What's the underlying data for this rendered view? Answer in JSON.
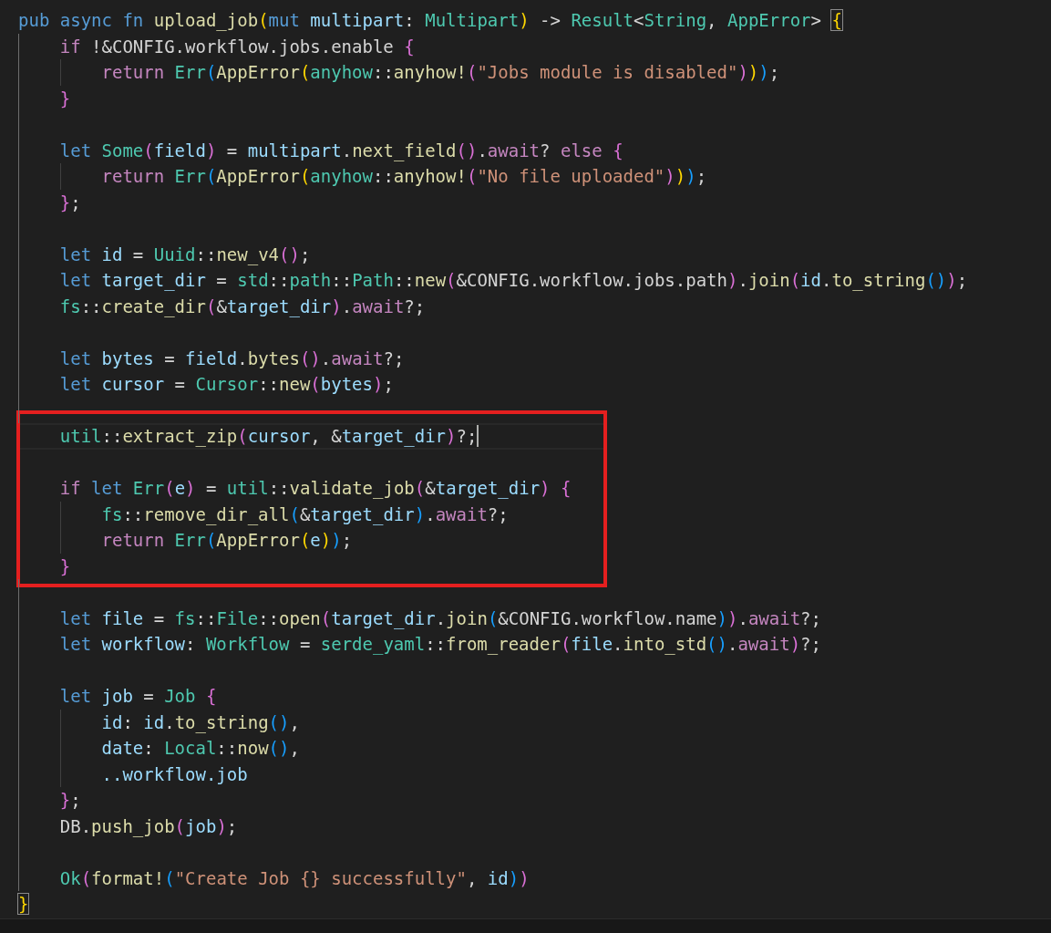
{
  "editor": {
    "lines": [
      {
        "kind": "code",
        "tokens": [
          {
            "text": "pub",
            "kind": "keyword"
          },
          {
            "text": " async",
            "kind": "keyword"
          },
          {
            "text": " fn",
            "kind": "keyword"
          },
          {
            "text": " upload_job",
            "kind": "function"
          },
          {
            "text": "(",
            "kind": "bracket1"
          },
          {
            "text": "mut",
            "kind": "keyword"
          },
          {
            "text": " multipart",
            "kind": "variable"
          },
          {
            "text": ": ",
            "kind": "plain"
          },
          {
            "text": "Multipart",
            "kind": "type"
          },
          {
            "text": ")",
            "kind": "bracket1"
          },
          {
            "text": " -> ",
            "kind": "plain"
          },
          {
            "text": "Result",
            "kind": "type"
          },
          {
            "text": "<",
            "kind": "plain"
          },
          {
            "text": "String",
            "kind": "type"
          },
          {
            "text": ", ",
            "kind": "plain"
          },
          {
            "text": "AppError",
            "kind": "type"
          },
          {
            "text": "> ",
            "kind": "plain"
          },
          {
            "text": "{",
            "kind": "bracket1",
            "matched": true
          }
        ],
        "children": [
          {
            "kind": "code",
            "tokens": [
              {
                "text": "if",
                "kind": "control"
              },
              {
                "text": " !&CONFIG.workflow.jobs.enable ",
                "kind": "plain"
              },
              {
                "text": "{",
                "kind": "bracket2"
              }
            ],
            "children": [
              {
                "kind": "code",
                "tokens": [
                  {
                    "text": "return",
                    "kind": "control"
                  },
                  {
                    "text": " Err",
                    "kind": "type"
                  },
                  {
                    "text": "(",
                    "kind": "bracket3"
                  },
                  {
                    "text": "AppError",
                    "kind": "function"
                  },
                  {
                    "text": "(",
                    "kind": "bracket1"
                  },
                  {
                    "text": "anyhow",
                    "kind": "type"
                  },
                  {
                    "text": "::",
                    "kind": "plain"
                  },
                  {
                    "text": "anyhow!",
                    "kind": "function"
                  },
                  {
                    "text": "(",
                    "kind": "bracket2"
                  },
                  {
                    "text": "\"Jobs module is disabled\"",
                    "kind": "string"
                  },
                  {
                    "text": ")",
                    "kind": "bracket2"
                  },
                  {
                    "text": ")",
                    "kind": "bracket1"
                  },
                  {
                    "text": ")",
                    "kind": "bracket3"
                  },
                  {
                    "text": ";",
                    "kind": "plain"
                  }
                ]
              }
            ]
          },
          {
            "kind": "code",
            "tokens": [
              {
                "text": "}",
                "kind": "bracket2"
              }
            ]
          },
          {
            "kind": "blank"
          },
          {
            "kind": "code",
            "tokens": [
              {
                "text": "let",
                "kind": "keyword"
              },
              {
                "text": " Some",
                "kind": "type"
              },
              {
                "text": "(",
                "kind": "bracket2"
              },
              {
                "text": "field",
                "kind": "variable"
              },
              {
                "text": ")",
                "kind": "bracket2"
              },
              {
                "text": " = ",
                "kind": "plain"
              },
              {
                "text": "multipart",
                "kind": "variable"
              },
              {
                "text": ".",
                "kind": "plain"
              },
              {
                "text": "next_field",
                "kind": "function"
              },
              {
                "text": "()",
                "kind": "bracket2"
              },
              {
                "text": ".",
                "kind": "plain"
              },
              {
                "text": "await",
                "kind": "control"
              },
              {
                "text": "? ",
                "kind": "plain"
              },
              {
                "text": "else",
                "kind": "control"
              },
              {
                "text": " {",
                "kind": "bracket2"
              }
            ],
            "children": [
              {
                "kind": "code",
                "tokens": [
                  {
                    "text": "return",
                    "kind": "control"
                  },
                  {
                    "text": " Err",
                    "kind": "type"
                  },
                  {
                    "text": "(",
                    "kind": "bracket3"
                  },
                  {
                    "text": "AppError",
                    "kind": "function"
                  },
                  {
                    "text": "(",
                    "kind": "bracket1"
                  },
                  {
                    "text": "anyhow",
                    "kind": "type"
                  },
                  {
                    "text": "::",
                    "kind": "plain"
                  },
                  {
                    "text": "anyhow!",
                    "kind": "function"
                  },
                  {
                    "text": "(",
                    "kind": "bracket2"
                  },
                  {
                    "text": "\"No file uploaded\"",
                    "kind": "string"
                  },
                  {
                    "text": ")",
                    "kind": "bracket2"
                  },
                  {
                    "text": ")",
                    "kind": "bracket1"
                  },
                  {
                    "text": ")",
                    "kind": "bracket3"
                  },
                  {
                    "text": ";",
                    "kind": "plain"
                  }
                ]
              }
            ]
          },
          {
            "kind": "code",
            "tokens": [
              {
                "text": "}",
                "kind": "bracket2"
              },
              {
                "text": ";",
                "kind": "plain"
              }
            ]
          },
          {
            "kind": "blank"
          },
          {
            "kind": "code",
            "tokens": [
              {
                "text": "let",
                "kind": "keyword"
              },
              {
                "text": " id",
                "kind": "variable"
              },
              {
                "text": " = ",
                "kind": "plain"
              },
              {
                "text": "Uuid",
                "kind": "type"
              },
              {
                "text": "::",
                "kind": "plain"
              },
              {
                "text": "new_v4",
                "kind": "function"
              },
              {
                "text": "()",
                "kind": "bracket2"
              },
              {
                "text": ";",
                "kind": "plain"
              }
            ]
          },
          {
            "kind": "code",
            "tokens": [
              {
                "text": "let",
                "kind": "keyword"
              },
              {
                "text": " target_dir",
                "kind": "variable"
              },
              {
                "text": " = ",
                "kind": "plain"
              },
              {
                "text": "std",
                "kind": "type"
              },
              {
                "text": "::",
                "kind": "plain"
              },
              {
                "text": "path",
                "kind": "type"
              },
              {
                "text": "::",
                "kind": "plain"
              },
              {
                "text": "Path",
                "kind": "type"
              },
              {
                "text": "::",
                "kind": "plain"
              },
              {
                "text": "new",
                "kind": "function"
              },
              {
                "text": "(",
                "kind": "bracket2"
              },
              {
                "text": "&CONFIG.workflow.jobs.path",
                "kind": "plain"
              },
              {
                "text": ")",
                "kind": "bracket2"
              },
              {
                "text": ".",
                "kind": "plain"
              },
              {
                "text": "join",
                "kind": "function"
              },
              {
                "text": "(",
                "kind": "bracket2"
              },
              {
                "text": "id",
                "kind": "variable"
              },
              {
                "text": ".",
                "kind": "plain"
              },
              {
                "text": "to_string",
                "kind": "function"
              },
              {
                "text": "()",
                "kind": "bracket3"
              },
              {
                "text": ")",
                "kind": "bracket2"
              },
              {
                "text": ";",
                "kind": "plain"
              }
            ]
          },
          {
            "kind": "code",
            "tokens": [
              {
                "text": "fs",
                "kind": "type"
              },
              {
                "text": "::",
                "kind": "plain"
              },
              {
                "text": "create_dir",
                "kind": "function"
              },
              {
                "text": "(",
                "kind": "bracket2"
              },
              {
                "text": "&",
                "kind": "plain"
              },
              {
                "text": "target_dir",
                "kind": "variable"
              },
              {
                "text": ")",
                "kind": "bracket2"
              },
              {
                "text": ".",
                "kind": "plain"
              },
              {
                "text": "await",
                "kind": "control"
              },
              {
                "text": "?;",
                "kind": "plain"
              }
            ]
          },
          {
            "kind": "blank"
          },
          {
            "kind": "code",
            "tokens": [
              {
                "text": "let",
                "kind": "keyword"
              },
              {
                "text": " bytes",
                "kind": "variable"
              },
              {
                "text": " = ",
                "kind": "plain"
              },
              {
                "text": "field",
                "kind": "variable"
              },
              {
                "text": ".",
                "kind": "plain"
              },
              {
                "text": "bytes",
                "kind": "function"
              },
              {
                "text": "()",
                "kind": "bracket2"
              },
              {
                "text": ".",
                "kind": "plain"
              },
              {
                "text": "await",
                "kind": "control"
              },
              {
                "text": "?;",
                "kind": "plain"
              }
            ]
          },
          {
            "kind": "code",
            "tokens": [
              {
                "text": "let",
                "kind": "keyword"
              },
              {
                "text": " cursor",
                "kind": "variable"
              },
              {
                "text": " = ",
                "kind": "plain"
              },
              {
                "text": "Cursor",
                "kind": "type"
              },
              {
                "text": "::",
                "kind": "plain"
              },
              {
                "text": "new",
                "kind": "function"
              },
              {
                "text": "(",
                "kind": "bracket2"
              },
              {
                "text": "bytes",
                "kind": "variable"
              },
              {
                "text": ")",
                "kind": "bracket2"
              },
              {
                "text": ";",
                "kind": "plain"
              }
            ]
          },
          {
            "kind": "blank"
          },
          {
            "kind": "highlight",
            "children": [
              {
                "kind": "code",
                "current": true,
                "tokens": [
                  {
                    "text": "util",
                    "kind": "type"
                  },
                  {
                    "text": "::",
                    "kind": "plain"
                  },
                  {
                    "text": "extract_zip",
                    "kind": "function"
                  },
                  {
                    "text": "(",
                    "kind": "bracket2"
                  },
                  {
                    "text": "cursor",
                    "kind": "variable"
                  },
                  {
                    "text": ", &",
                    "kind": "plain"
                  },
                  {
                    "text": "target_dir",
                    "kind": "variable"
                  },
                  {
                    "text": ")",
                    "kind": "bracket2"
                  },
                  {
                    "text": "?;",
                    "kind": "plain"
                  }
                ]
              },
              {
                "kind": "blank"
              },
              {
                "kind": "code",
                "tokens": [
                  {
                    "text": "if",
                    "kind": "control"
                  },
                  {
                    "text": " let",
                    "kind": "keyword"
                  },
                  {
                    "text": " Err",
                    "kind": "type"
                  },
                  {
                    "text": "(",
                    "kind": "bracket2"
                  },
                  {
                    "text": "e",
                    "kind": "variable"
                  },
                  {
                    "text": ")",
                    "kind": "bracket2"
                  },
                  {
                    "text": " = ",
                    "kind": "plain"
                  },
                  {
                    "text": "util",
                    "kind": "type"
                  },
                  {
                    "text": "::",
                    "kind": "plain"
                  },
                  {
                    "text": "validate_job",
                    "kind": "function"
                  },
                  {
                    "text": "(",
                    "kind": "bracket2"
                  },
                  {
                    "text": "&",
                    "kind": "plain"
                  },
                  {
                    "text": "target_dir",
                    "kind": "variable"
                  },
                  {
                    "text": ")",
                    "kind": "bracket2"
                  },
                  {
                    "text": " {",
                    "kind": "bracket2"
                  }
                ],
                "children": [
                  {
                    "kind": "code",
                    "tokens": [
                      {
                        "text": "fs",
                        "kind": "type"
                      },
                      {
                        "text": "::",
                        "kind": "plain"
                      },
                      {
                        "text": "remove_dir_all",
                        "kind": "function"
                      },
                      {
                        "text": "(",
                        "kind": "bracket3"
                      },
                      {
                        "text": "&",
                        "kind": "plain"
                      },
                      {
                        "text": "target_dir",
                        "kind": "variable"
                      },
                      {
                        "text": ")",
                        "kind": "bracket3"
                      },
                      {
                        "text": ".",
                        "kind": "plain"
                      },
                      {
                        "text": "await",
                        "kind": "control"
                      },
                      {
                        "text": "?;",
                        "kind": "plain"
                      }
                    ]
                  },
                  {
                    "kind": "code",
                    "tokens": [
                      {
                        "text": "return",
                        "kind": "control"
                      },
                      {
                        "text": " Err",
                        "kind": "type"
                      },
                      {
                        "text": "(",
                        "kind": "bracket3"
                      },
                      {
                        "text": "AppError",
                        "kind": "function"
                      },
                      {
                        "text": "(",
                        "kind": "bracket1"
                      },
                      {
                        "text": "e",
                        "kind": "variable"
                      },
                      {
                        "text": ")",
                        "kind": "bracket1"
                      },
                      {
                        "text": ")",
                        "kind": "bracket3"
                      },
                      {
                        "text": ";",
                        "kind": "plain"
                      }
                    ]
                  }
                ]
              },
              {
                "kind": "code",
                "tokens": [
                  {
                    "text": "}",
                    "kind": "bracket2"
                  }
                ]
              }
            ]
          },
          {
            "kind": "blank"
          },
          {
            "kind": "code",
            "tokens": [
              {
                "text": "let",
                "kind": "keyword"
              },
              {
                "text": " file",
                "kind": "variable"
              },
              {
                "text": " = ",
                "kind": "plain"
              },
              {
                "text": "fs",
                "kind": "type"
              },
              {
                "text": "::",
                "kind": "plain"
              },
              {
                "text": "File",
                "kind": "type"
              },
              {
                "text": "::",
                "kind": "plain"
              },
              {
                "text": "open",
                "kind": "function"
              },
              {
                "text": "(",
                "kind": "bracket2"
              },
              {
                "text": "target_dir",
                "kind": "variable"
              },
              {
                "text": ".",
                "kind": "plain"
              },
              {
                "text": "join",
                "kind": "function"
              },
              {
                "text": "(",
                "kind": "bracket3"
              },
              {
                "text": "&CONFIG.workflow.name",
                "kind": "plain"
              },
              {
                "text": ")",
                "kind": "bracket3"
              },
              {
                "text": ")",
                "kind": "bracket2"
              },
              {
                "text": ".",
                "kind": "plain"
              },
              {
                "text": "await",
                "kind": "control"
              },
              {
                "text": "?;",
                "kind": "plain"
              }
            ]
          },
          {
            "kind": "code",
            "tokens": [
              {
                "text": "let",
                "kind": "keyword"
              },
              {
                "text": " workflow",
                "kind": "variable"
              },
              {
                "text": ": ",
                "kind": "plain"
              },
              {
                "text": "Workflow",
                "kind": "type"
              },
              {
                "text": " = ",
                "kind": "plain"
              },
              {
                "text": "serde_yaml",
                "kind": "type"
              },
              {
                "text": "::",
                "kind": "plain"
              },
              {
                "text": "from_reader",
                "kind": "function"
              },
              {
                "text": "(",
                "kind": "bracket2"
              },
              {
                "text": "file",
                "kind": "variable"
              },
              {
                "text": ".",
                "kind": "plain"
              },
              {
                "text": "into_std",
                "kind": "function"
              },
              {
                "text": "()",
                "kind": "bracket3"
              },
              {
                "text": ".",
                "kind": "plain"
              },
              {
                "text": "await",
                "kind": "control"
              },
              {
                "text": ")",
                "kind": "bracket2"
              },
              {
                "text": "?;",
                "kind": "plain"
              }
            ]
          },
          {
            "kind": "blank"
          },
          {
            "kind": "code",
            "tokens": [
              {
                "text": "let",
                "kind": "keyword"
              },
              {
                "text": " job",
                "kind": "variable"
              },
              {
                "text": " = ",
                "kind": "plain"
              },
              {
                "text": "Job",
                "kind": "type"
              },
              {
                "text": " {",
                "kind": "bracket2"
              }
            ],
            "children": [
              {
                "kind": "code",
                "tokens": [
                  {
                    "text": "id",
                    "kind": "variable"
                  },
                  {
                    "text": ": ",
                    "kind": "plain"
                  },
                  {
                    "text": "id",
                    "kind": "variable"
                  },
                  {
                    "text": ".",
                    "kind": "plain"
                  },
                  {
                    "text": "to_string",
                    "kind": "function"
                  },
                  {
                    "text": "()",
                    "kind": "bracket3"
                  },
                  {
                    "text": ",",
                    "kind": "plain"
                  }
                ]
              },
              {
                "kind": "code",
                "tokens": [
                  {
                    "text": "date",
                    "kind": "variable"
                  },
                  {
                    "text": ": ",
                    "kind": "plain"
                  },
                  {
                    "text": "Local",
                    "kind": "type"
                  },
                  {
                    "text": "::",
                    "kind": "plain"
                  },
                  {
                    "text": "now",
                    "kind": "function"
                  },
                  {
                    "text": "()",
                    "kind": "bracket3"
                  },
                  {
                    "text": ",",
                    "kind": "plain"
                  }
                ]
              },
              {
                "kind": "code",
                "tokens": [
                  {
                    "text": "..workflow.job",
                    "kind": "variable"
                  }
                ]
              }
            ]
          },
          {
            "kind": "code",
            "tokens": [
              {
                "text": "}",
                "kind": "bracket2"
              },
              {
                "text": ";",
                "kind": "plain"
              }
            ]
          },
          {
            "kind": "code",
            "tokens": [
              {
                "text": "DB.",
                "kind": "plain"
              },
              {
                "text": "push_job",
                "kind": "function"
              },
              {
                "text": "(",
                "kind": "bracket2"
              },
              {
                "text": "job",
                "kind": "variable"
              },
              {
                "text": ")",
                "kind": "bracket2"
              },
              {
                "text": ";",
                "kind": "plain"
              }
            ]
          },
          {
            "kind": "blank"
          },
          {
            "kind": "code",
            "tokens": [
              {
                "text": "Ok",
                "kind": "type"
              },
              {
                "text": "(",
                "kind": "bracket2"
              },
              {
                "text": "format!",
                "kind": "function"
              },
              {
                "text": "(",
                "kind": "bracket3"
              },
              {
                "text": "\"Create Job {} successfully\"",
                "kind": "string"
              },
              {
                "text": ", ",
                "kind": "plain"
              },
              {
                "text": "id",
                "kind": "variable"
              },
              {
                "text": ")",
                "kind": "bracket3"
              },
              {
                "text": ")",
                "kind": "bracket2"
              }
            ]
          }
        ]
      },
      {
        "kind": "code",
        "tokens": [
          {
            "text": "}",
            "kind": "bracket1",
            "matched": true
          }
        ]
      }
    ]
  }
}
